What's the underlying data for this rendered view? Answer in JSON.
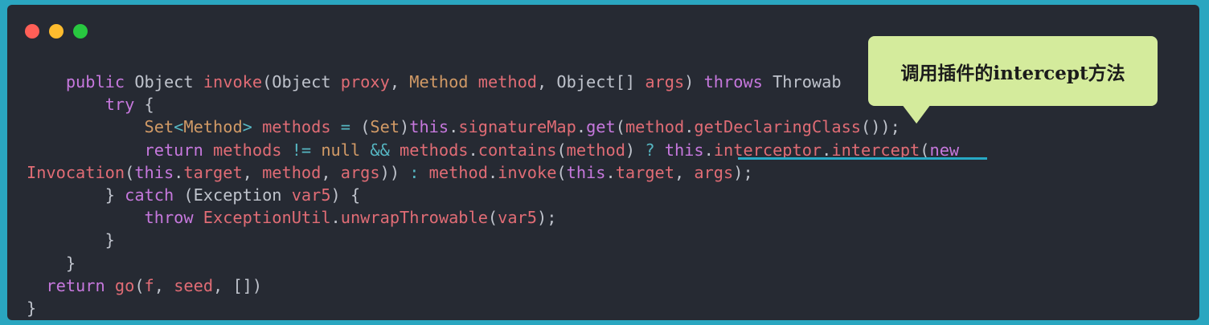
{
  "window": {
    "traffic_lights": [
      {
        "name": "close",
        "color": "#ff5f57"
      },
      {
        "name": "minimize",
        "color": "#febc2e"
      },
      {
        "name": "zoom",
        "color": "#28c840"
      }
    ]
  },
  "code": {
    "lines": [
      [
        {
          "t": "    ",
          "c": "pl"
        },
        {
          "t": "public ",
          "c": "kw"
        },
        {
          "t": "Object ",
          "c": "pl"
        },
        {
          "t": "invoke",
          "c": "fn"
        },
        {
          "t": "(Object ",
          "c": "pl"
        },
        {
          "t": "proxy",
          "c": "va"
        },
        {
          "t": ", ",
          "c": "pl"
        },
        {
          "t": "Method ",
          "c": "ty"
        },
        {
          "t": "method",
          "c": "va"
        },
        {
          "t": ", Object[] ",
          "c": "pl"
        },
        {
          "t": "args",
          "c": "va"
        },
        {
          "t": ") ",
          "c": "pl"
        },
        {
          "t": "throws ",
          "c": "kw"
        },
        {
          "t": "Throwab",
          "c": "pl"
        }
      ],
      [
        {
          "t": "        ",
          "c": "pl"
        },
        {
          "t": "try",
          "c": "kw"
        },
        {
          "t": " {",
          "c": "pl"
        }
      ],
      [
        {
          "t": "            ",
          "c": "pl"
        },
        {
          "t": "Set",
          "c": "ty"
        },
        {
          "t": "<",
          "c": "op"
        },
        {
          "t": "Method",
          "c": "ty"
        },
        {
          "t": "> ",
          "c": "op"
        },
        {
          "t": "methods ",
          "c": "va"
        },
        {
          "t": "= ",
          "c": "op"
        },
        {
          "t": "(",
          "c": "pl"
        },
        {
          "t": "Set",
          "c": "ty"
        },
        {
          "t": ")",
          "c": "pl"
        },
        {
          "t": "this",
          "c": "kw"
        },
        {
          "t": ".",
          "c": "pl"
        },
        {
          "t": "signatureMap",
          "c": "va"
        },
        {
          "t": ".",
          "c": "pl"
        },
        {
          "t": "get",
          "c": "kw"
        },
        {
          "t": "(",
          "c": "pl"
        },
        {
          "t": "method",
          "c": "va"
        },
        {
          "t": ".",
          "c": "pl"
        },
        {
          "t": "getDeclaringClass",
          "c": "va"
        },
        {
          "t": "());",
          "c": "pl"
        }
      ],
      [
        {
          "t": "            ",
          "c": "pl"
        },
        {
          "t": "return ",
          "c": "kw"
        },
        {
          "t": "methods ",
          "c": "va"
        },
        {
          "t": "!= ",
          "c": "op"
        },
        {
          "t": "null ",
          "c": "ty"
        },
        {
          "t": "&& ",
          "c": "op"
        },
        {
          "t": "methods",
          "c": "va"
        },
        {
          "t": ".",
          "c": "pl"
        },
        {
          "t": "contains",
          "c": "va"
        },
        {
          "t": "(",
          "c": "pl"
        },
        {
          "t": "method",
          "c": "va"
        },
        {
          "t": ") ",
          "c": "pl"
        },
        {
          "t": "? ",
          "c": "op"
        },
        {
          "t": "this",
          "c": "kw"
        },
        {
          "t": ".",
          "c": "pl"
        },
        {
          "t": "interceptor",
          "c": "va"
        },
        {
          "t": ".",
          "c": "pl"
        },
        {
          "t": "intercept",
          "c": "va"
        },
        {
          "t": "(",
          "c": "pl"
        },
        {
          "t": "new",
          "c": "kw"
        }
      ],
      [
        {
          "t": "Invocation",
          "c": "va"
        },
        {
          "t": "(",
          "c": "pl"
        },
        {
          "t": "this",
          "c": "kw"
        },
        {
          "t": ".",
          "c": "pl"
        },
        {
          "t": "target",
          "c": "va"
        },
        {
          "t": ", ",
          "c": "pl"
        },
        {
          "t": "method",
          "c": "va"
        },
        {
          "t": ", ",
          "c": "pl"
        },
        {
          "t": "args",
          "c": "va"
        },
        {
          "t": ")) ",
          "c": "pl"
        },
        {
          "t": ": ",
          "c": "op"
        },
        {
          "t": "method",
          "c": "va"
        },
        {
          "t": ".",
          "c": "pl"
        },
        {
          "t": "invoke",
          "c": "va"
        },
        {
          "t": "(",
          "c": "pl"
        },
        {
          "t": "this",
          "c": "kw"
        },
        {
          "t": ".",
          "c": "pl"
        },
        {
          "t": "target",
          "c": "va"
        },
        {
          "t": ", ",
          "c": "pl"
        },
        {
          "t": "args",
          "c": "va"
        },
        {
          "t": ");",
          "c": "pl"
        }
      ],
      [
        {
          "t": "        ",
          "c": "pl"
        },
        {
          "t": "} ",
          "c": "pl"
        },
        {
          "t": "catch",
          "c": "kw"
        },
        {
          "t": " (Exception ",
          "c": "pl"
        },
        {
          "t": "var5",
          "c": "va"
        },
        {
          "t": ") {",
          "c": "pl"
        }
      ],
      [
        {
          "t": "            ",
          "c": "pl"
        },
        {
          "t": "throw ",
          "c": "kw"
        },
        {
          "t": "ExceptionUtil",
          "c": "va"
        },
        {
          "t": ".",
          "c": "pl"
        },
        {
          "t": "unwrapThrowable",
          "c": "va"
        },
        {
          "t": "(",
          "c": "pl"
        },
        {
          "t": "var5",
          "c": "va"
        },
        {
          "t": ");",
          "c": "pl"
        }
      ],
      [
        {
          "t": "        }",
          "c": "pl"
        }
      ],
      [
        {
          "t": "    }",
          "c": "pl"
        }
      ],
      [
        {
          "t": "  ",
          "c": "pl"
        },
        {
          "t": "return ",
          "c": "kw"
        },
        {
          "t": "go",
          "c": "fn"
        },
        {
          "t": "(",
          "c": "pl"
        },
        {
          "t": "f",
          "c": "va"
        },
        {
          "t": ", ",
          "c": "pl"
        },
        {
          "t": "seed",
          "c": "va"
        },
        {
          "t": ", [])",
          "c": "pl"
        }
      ],
      [
        {
          "t": "}",
          "c": "pl"
        }
      ]
    ]
  },
  "callout": {
    "text": "调用插件的intercept方法",
    "background": "#d4eb9c",
    "underline_color": "#27a9c5"
  }
}
